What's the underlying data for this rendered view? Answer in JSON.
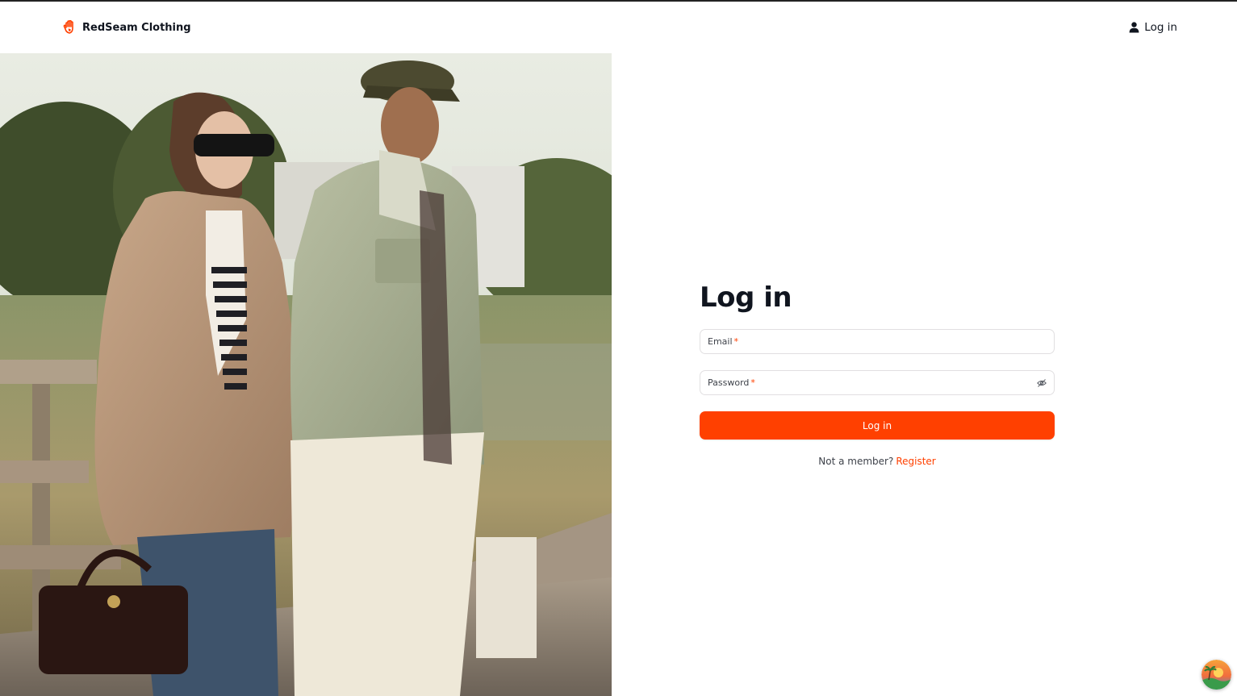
{
  "brand": {
    "name": "RedSeam Clothing",
    "logo_icon": "hand-flame-icon",
    "accent_color": "#ff4000"
  },
  "header": {
    "login_label": "Log in",
    "login_icon": "user-icon"
  },
  "hero": {
    "image_icon": "fashion-photo"
  },
  "form": {
    "title": "Log in",
    "email_label": "Email",
    "password_label": "Password",
    "required_mark": "*",
    "password_toggle_icon": "eye-icon",
    "submit_label": "Log in",
    "register_prompt": "Not a member?",
    "register_link": "Register"
  },
  "floating_badge": {
    "icon": "landscape-badge-icon"
  }
}
